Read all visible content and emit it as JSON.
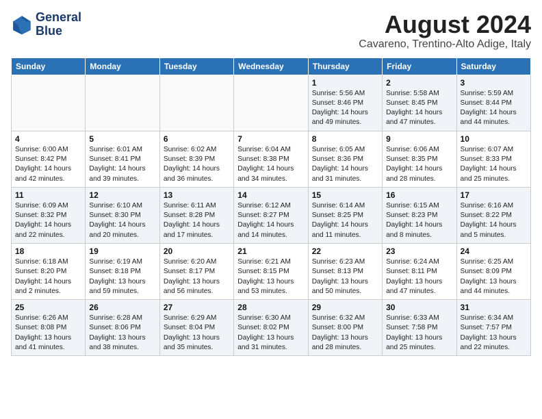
{
  "logo": {
    "line1": "General",
    "line2": "Blue"
  },
  "title": {
    "month_year": "August 2024",
    "location": "Cavareno, Trentino-Alto Adige, Italy"
  },
  "weekdays": [
    "Sunday",
    "Monday",
    "Tuesday",
    "Wednesday",
    "Thursday",
    "Friday",
    "Saturday"
  ],
  "weeks": [
    [
      {
        "day": "",
        "info": ""
      },
      {
        "day": "",
        "info": ""
      },
      {
        "day": "",
        "info": ""
      },
      {
        "day": "",
        "info": ""
      },
      {
        "day": "1",
        "info": "Sunrise: 5:56 AM\nSunset: 8:46 PM\nDaylight: 14 hours and 49 minutes."
      },
      {
        "day": "2",
        "info": "Sunrise: 5:58 AM\nSunset: 8:45 PM\nDaylight: 14 hours and 47 minutes."
      },
      {
        "day": "3",
        "info": "Sunrise: 5:59 AM\nSunset: 8:44 PM\nDaylight: 14 hours and 44 minutes."
      }
    ],
    [
      {
        "day": "4",
        "info": "Sunrise: 6:00 AM\nSunset: 8:42 PM\nDaylight: 14 hours and 42 minutes."
      },
      {
        "day": "5",
        "info": "Sunrise: 6:01 AM\nSunset: 8:41 PM\nDaylight: 14 hours and 39 minutes."
      },
      {
        "day": "6",
        "info": "Sunrise: 6:02 AM\nSunset: 8:39 PM\nDaylight: 14 hours and 36 minutes."
      },
      {
        "day": "7",
        "info": "Sunrise: 6:04 AM\nSunset: 8:38 PM\nDaylight: 14 hours and 34 minutes."
      },
      {
        "day": "8",
        "info": "Sunrise: 6:05 AM\nSunset: 8:36 PM\nDaylight: 14 hours and 31 minutes."
      },
      {
        "day": "9",
        "info": "Sunrise: 6:06 AM\nSunset: 8:35 PM\nDaylight: 14 hours and 28 minutes."
      },
      {
        "day": "10",
        "info": "Sunrise: 6:07 AM\nSunset: 8:33 PM\nDaylight: 14 hours and 25 minutes."
      }
    ],
    [
      {
        "day": "11",
        "info": "Sunrise: 6:09 AM\nSunset: 8:32 PM\nDaylight: 14 hours and 22 minutes."
      },
      {
        "day": "12",
        "info": "Sunrise: 6:10 AM\nSunset: 8:30 PM\nDaylight: 14 hours and 20 minutes."
      },
      {
        "day": "13",
        "info": "Sunrise: 6:11 AM\nSunset: 8:28 PM\nDaylight: 14 hours and 17 minutes."
      },
      {
        "day": "14",
        "info": "Sunrise: 6:12 AM\nSunset: 8:27 PM\nDaylight: 14 hours and 14 minutes."
      },
      {
        "day": "15",
        "info": "Sunrise: 6:14 AM\nSunset: 8:25 PM\nDaylight: 14 hours and 11 minutes."
      },
      {
        "day": "16",
        "info": "Sunrise: 6:15 AM\nSunset: 8:23 PM\nDaylight: 14 hours and 8 minutes."
      },
      {
        "day": "17",
        "info": "Sunrise: 6:16 AM\nSunset: 8:22 PM\nDaylight: 14 hours and 5 minutes."
      }
    ],
    [
      {
        "day": "18",
        "info": "Sunrise: 6:18 AM\nSunset: 8:20 PM\nDaylight: 14 hours and 2 minutes."
      },
      {
        "day": "19",
        "info": "Sunrise: 6:19 AM\nSunset: 8:18 PM\nDaylight: 13 hours and 59 minutes."
      },
      {
        "day": "20",
        "info": "Sunrise: 6:20 AM\nSunset: 8:17 PM\nDaylight: 13 hours and 56 minutes."
      },
      {
        "day": "21",
        "info": "Sunrise: 6:21 AM\nSunset: 8:15 PM\nDaylight: 13 hours and 53 minutes."
      },
      {
        "day": "22",
        "info": "Sunrise: 6:23 AM\nSunset: 8:13 PM\nDaylight: 13 hours and 50 minutes."
      },
      {
        "day": "23",
        "info": "Sunrise: 6:24 AM\nSunset: 8:11 PM\nDaylight: 13 hours and 47 minutes."
      },
      {
        "day": "24",
        "info": "Sunrise: 6:25 AM\nSunset: 8:09 PM\nDaylight: 13 hours and 44 minutes."
      }
    ],
    [
      {
        "day": "25",
        "info": "Sunrise: 6:26 AM\nSunset: 8:08 PM\nDaylight: 13 hours and 41 minutes."
      },
      {
        "day": "26",
        "info": "Sunrise: 6:28 AM\nSunset: 8:06 PM\nDaylight: 13 hours and 38 minutes."
      },
      {
        "day": "27",
        "info": "Sunrise: 6:29 AM\nSunset: 8:04 PM\nDaylight: 13 hours and 35 minutes."
      },
      {
        "day": "28",
        "info": "Sunrise: 6:30 AM\nSunset: 8:02 PM\nDaylight: 13 hours and 31 minutes."
      },
      {
        "day": "29",
        "info": "Sunrise: 6:32 AM\nSunset: 8:00 PM\nDaylight: 13 hours and 28 minutes."
      },
      {
        "day": "30",
        "info": "Sunrise: 6:33 AM\nSunset: 7:58 PM\nDaylight: 13 hours and 25 minutes."
      },
      {
        "day": "31",
        "info": "Sunrise: 6:34 AM\nSunset: 7:57 PM\nDaylight: 13 hours and 22 minutes."
      }
    ]
  ]
}
